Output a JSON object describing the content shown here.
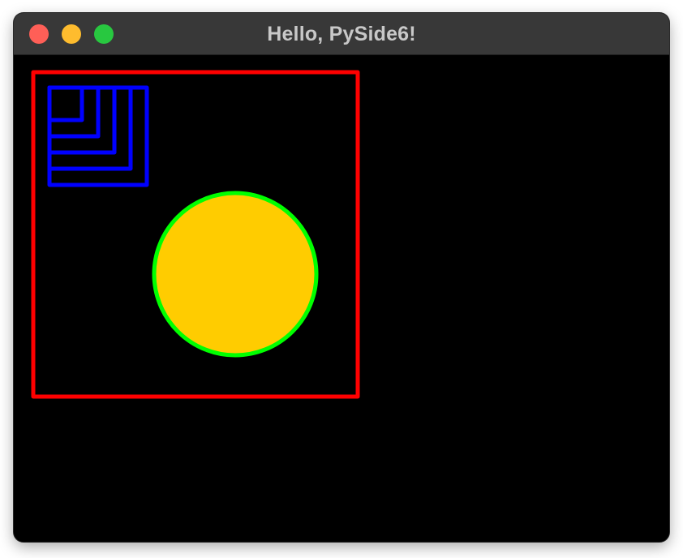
{
  "window": {
    "title": "Hello, PySide6!",
    "background_color": "#000000",
    "titlebar_color": "#383838",
    "title_color": "#c8c8c8"
  },
  "traffic_lights": {
    "close_color": "#ff5f57",
    "minimize_color": "#febc2e",
    "zoom_color": "#28c840"
  },
  "canvas": {
    "outer_square_color": "#ff0000",
    "nested_squares_color": "#0000ff",
    "circle_fill_color": "#ffcc00",
    "circle_outline_color": "#00ff00"
  }
}
